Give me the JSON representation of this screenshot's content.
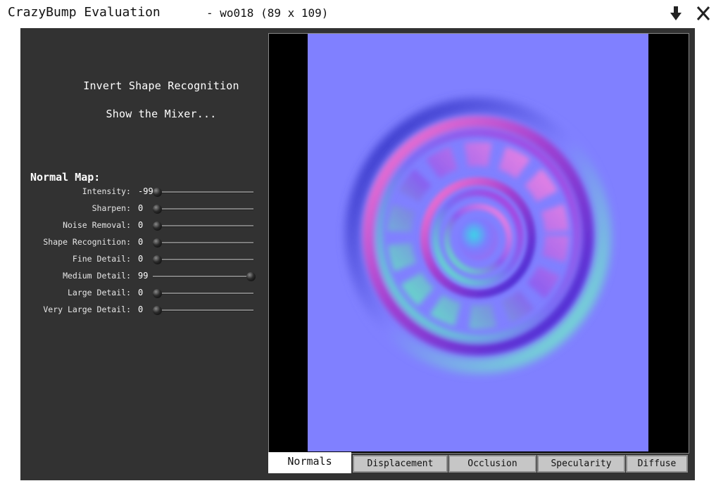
{
  "window": {
    "title": "CrazyBump Evaluation",
    "file_info": "- wo018 (89 x 109)"
  },
  "actions": {
    "invert": "Invert Shape Recognition",
    "mixer": "Show the Mixer..."
  },
  "normal_map": {
    "title": "Normal Map:",
    "sliders": [
      {
        "label": "Intensity:",
        "value": "-99",
        "level": 0.0
      },
      {
        "label": "Sharpen:",
        "value": "0",
        "level": 0.0
      },
      {
        "label": "Noise Removal:",
        "value": "0",
        "level": 0.0
      },
      {
        "label": "Shape Recognition:",
        "value": "0",
        "level": 0.0
      },
      {
        "label": "Fine Detail:",
        "value": "0",
        "level": 0.0
      },
      {
        "label": "Medium Detail:",
        "value": "99",
        "level": 1.0
      },
      {
        "label": "Large Detail:",
        "value": "0",
        "level": 0.0
      },
      {
        "label": "Very Large Detail:",
        "value": "0",
        "level": 0.0
      }
    ]
  },
  "tabs": [
    {
      "label": "Normals",
      "active": true
    },
    {
      "label": "Displacement",
      "active": false
    },
    {
      "label": "Occlusion",
      "active": false
    },
    {
      "label": "Specularity",
      "active": false
    },
    {
      "label": "Diffuse",
      "active": false
    }
  ],
  "colors": {
    "panel": "#323232",
    "normal_flat": "#8080ff",
    "tab_active": "#ffffff",
    "tab_inactive": "#c6c6c6"
  },
  "icons": {
    "download": "download-arrow-icon",
    "close": "close-x-icon"
  }
}
